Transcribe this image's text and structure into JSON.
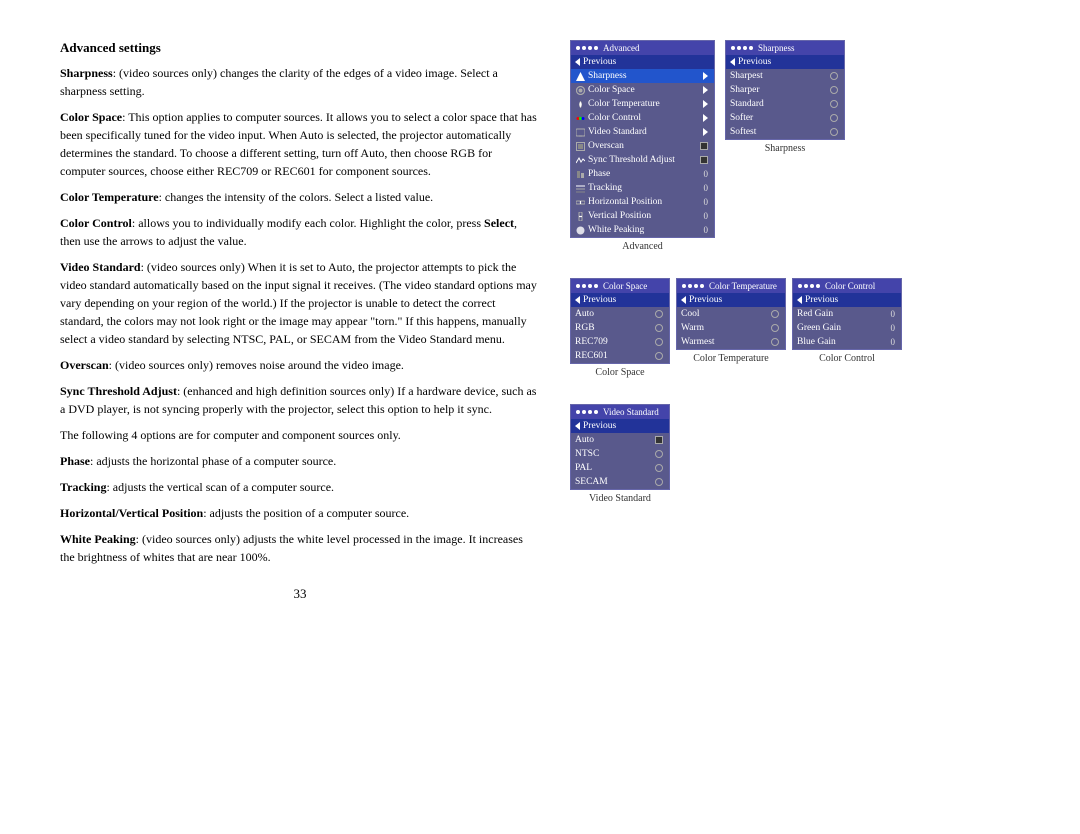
{
  "page": {
    "number": "33"
  },
  "section": {
    "title": "Advanced settings",
    "paragraphs": [
      {
        "bold_start": "Sharpness",
        "text": ": (video sources only) changes the clarity of the edges of a video image. Select a sharpness setting."
      },
      {
        "bold_start": "Color Space",
        "text": ": This option applies to computer sources. It allows you to select a color space that has been specifically tuned for the video input. When Auto is selected, the projector automatically determines the standard. To choose a different setting, turn off Auto, then choose RGB for computer sources, choose either REC709 or REC601 for component sources."
      },
      {
        "bold_start": "Color Temperature",
        "text": ": changes the intensity of the colors. Select a listed value."
      },
      {
        "bold_start": "Color Control",
        "text": ": allows you to individually modify each color. Highlight the color, press Select, then use the arrows to adjust the value."
      },
      {
        "bold_start": "Video Standard",
        "text": ": (video sources only) When it is set to Auto, the projector attempts to pick the video standard automatically based on the input signal it receives. (The video standard options may vary depending on your region of the world.) If the projector is unable to detect the correct standard, the colors may not look right or the image may appear \"torn.\" If this happens, manually select a video standard by selecting NTSC, PAL, or SECAM from the Video Standard menu."
      },
      {
        "bold_start": "Overscan",
        "text": ": (video sources only) removes noise around the video image."
      },
      {
        "bold_start": "Sync Threshold Adjust",
        "text": ": (enhanced and high definition sources only) If a hardware device, such as a DVD player, is not syncing properly with the projector, select this option to help it sync."
      },
      {
        "text_plain": "The following 4 options are for computer and component sources only."
      },
      {
        "bold_start": "Phase",
        "text": ": adjusts the horizontal phase of a computer source."
      },
      {
        "bold_start": "Tracking",
        "text": ": adjusts the vertical scan of a computer source."
      },
      {
        "bold_start": "Horizontal/Vertical Position",
        "text": ": adjusts the position of a computer source."
      },
      {
        "bold_start": "White Peaking",
        "text": ": (video sources only) adjusts the white level processed in the image. It increases the brightness of whites that are near 100%."
      }
    ]
  },
  "menus": {
    "advanced": {
      "title": "Advanced",
      "dots": 4,
      "items": [
        {
          "label": "Previous",
          "type": "prev"
        },
        {
          "label": "Sharpness",
          "type": "submenu",
          "selected": true
        },
        {
          "label": "Color Space",
          "type": "submenu"
        },
        {
          "label": "Color Temperature",
          "type": "submenu"
        },
        {
          "label": "Color Control",
          "type": "submenu"
        },
        {
          "label": "Video Standard",
          "type": "submenu"
        },
        {
          "label": "Overscan",
          "type": "checkbox",
          "value": ""
        },
        {
          "label": "Sync Threshold Adjust",
          "type": "checkbox",
          "value": ""
        },
        {
          "label": "Phase",
          "type": "value",
          "value": "0"
        },
        {
          "label": "Tracking",
          "type": "value",
          "value": "0"
        },
        {
          "label": "Horizontal Position",
          "type": "value",
          "value": "0"
        },
        {
          "label": "Vertical Position",
          "type": "value",
          "value": "0"
        },
        {
          "label": "White Peaking",
          "type": "value",
          "value": "0"
        }
      ],
      "menu_label": "Advanced"
    },
    "sharpness": {
      "title": "Sharpness",
      "dots": 4,
      "items": [
        {
          "label": "Previous",
          "type": "prev"
        },
        {
          "label": "Sharpest",
          "type": "radio"
        },
        {
          "label": "Sharper",
          "type": "radio"
        },
        {
          "label": "Standard",
          "type": "radio"
        },
        {
          "label": "Softer",
          "type": "radio"
        },
        {
          "label": "Softest",
          "type": "radio"
        }
      ],
      "menu_label": "Sharpness"
    },
    "color_space": {
      "title": "Color Space",
      "dots": 4,
      "items": [
        {
          "label": "Previous",
          "type": "prev"
        },
        {
          "label": "Auto",
          "type": "radio"
        },
        {
          "label": "RGB",
          "type": "radio"
        },
        {
          "label": "REC709",
          "type": "radio"
        },
        {
          "label": "REC601",
          "type": "radio"
        }
      ],
      "menu_label": "Color Space"
    },
    "color_temperature": {
      "title": "Color Temperature",
      "dots": 4,
      "items": [
        {
          "label": "Previous",
          "type": "prev"
        },
        {
          "label": "Cool",
          "type": "radio"
        },
        {
          "label": "Warm",
          "type": "radio"
        },
        {
          "label": "Warmest",
          "type": "radio"
        }
      ],
      "menu_label": "Color Temperature"
    },
    "color_control": {
      "title": "Color Control",
      "dots": 4,
      "items": [
        {
          "label": "Previous",
          "type": "prev"
        },
        {
          "label": "Red Gain",
          "type": "value",
          "value": "0"
        },
        {
          "label": "Green Gain",
          "type": "value",
          "value": "0"
        },
        {
          "label": "Blue Gain",
          "type": "value",
          "value": "0"
        }
      ],
      "menu_label": "Color Control"
    },
    "video_standard": {
      "title": "Video Standard",
      "dots": 4,
      "items": [
        {
          "label": "Previous",
          "type": "prev"
        },
        {
          "label": "Auto",
          "type": "checkbox",
          "value": ""
        },
        {
          "label": "NTSC",
          "type": "radio"
        },
        {
          "label": "PAL",
          "type": "radio"
        },
        {
          "label": "SECAM",
          "type": "radio"
        }
      ],
      "menu_label": "Video Standard"
    }
  }
}
